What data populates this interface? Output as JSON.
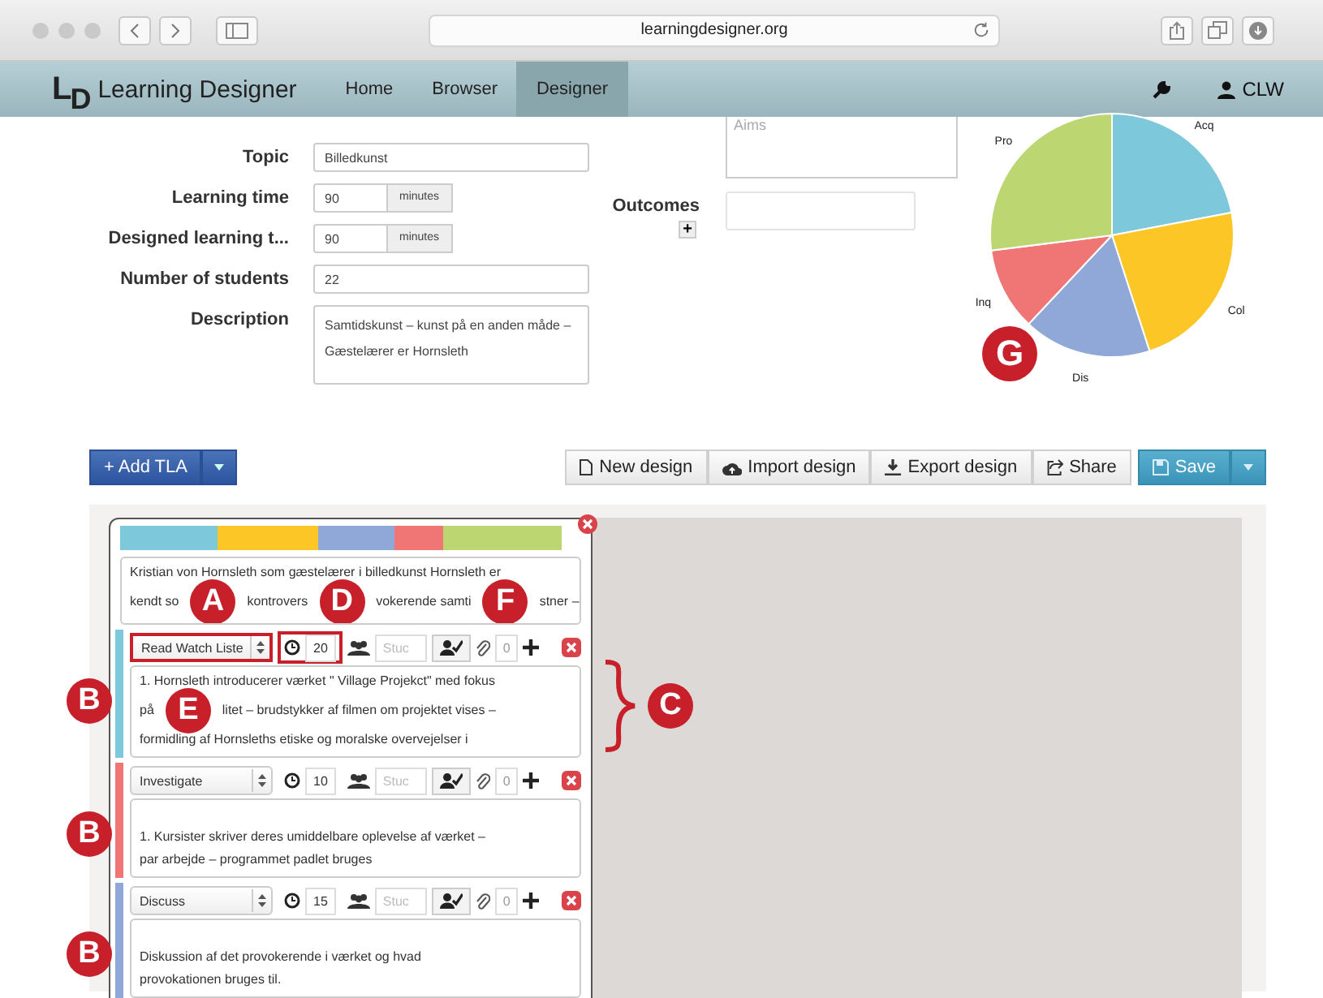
{
  "browser": {
    "address": "learningdesigner.org"
  },
  "nav": {
    "logo_l": "L",
    "logo_d": "D",
    "brand": "Learning Designer",
    "items": [
      {
        "label": "Home",
        "selected": false
      },
      {
        "label": "Browser",
        "selected": false
      },
      {
        "label": "Designer",
        "selected": true
      }
    ],
    "user": "CLW"
  },
  "form": [
    {
      "kind": "text",
      "label": "Topic",
      "value": "Billedkunst"
    },
    {
      "kind": "unit",
      "label": "Learning time",
      "value": "90",
      "unit": "minutes"
    },
    {
      "kind": "unit",
      "label": "Designed learning t...",
      "value": "90",
      "unit": "minutes"
    },
    {
      "kind": "text",
      "label": "Number of students",
      "value": "22"
    },
    {
      "kind": "area",
      "label": "Description",
      "value": "Samtidskunst – kunst på en anden måde – Gæstelærer er Hornsleth"
    }
  ],
  "aims": {
    "placeholder": "Aims"
  },
  "outcomes": {
    "label": "Outcomes",
    "add": "+"
  },
  "learning_types": [
    {
      "label": "Acq",
      "color": "#7ec8dc"
    },
    {
      "label": "Col",
      "color": "#fcc726"
    },
    {
      "label": "Dis",
      "color": "#8fa8d8"
    },
    {
      "label": "Inq",
      "color": "#f07575"
    },
    {
      "label": "Pro",
      "color": "#bcd672"
    }
  ],
  "pie_marker": "G",
  "toolbar": {
    "add": "+ Add TLA",
    "buttons": [
      {
        "kind": "new",
        "label": "New design"
      },
      {
        "kind": "import",
        "label": "Import design"
      },
      {
        "kind": "export",
        "label": "Export design"
      },
      {
        "kind": "share",
        "label": "Share"
      }
    ],
    "save": "Save"
  },
  "tla": {
    "description": [
      [
        {
          "kind": "text",
          "text": "Kristian von Hornsleth som gæstelærer i billedkunst Hornsleth er"
        }
      ],
      [
        {
          "kind": "text",
          "text": "kendt so"
        },
        {
          "kind": "marker",
          "letter": "A"
        },
        {
          "kind": "text",
          "text": "kontrovers"
        },
        {
          "kind": "marker",
          "letter": "D"
        },
        {
          "kind": "text",
          "text": "vokerende samti"
        },
        {
          "kind": "marker",
          "letter": "F"
        },
        {
          "kind": "text",
          "text": "stner –"
        }
      ]
    ],
    "activities": [
      {
        "type": "Read Watch Liste",
        "color": "#7ec8dc",
        "time": "20",
        "students": "Stuc",
        "count": "0",
        "highlighted": true,
        "marker": "B",
        "brace": "C",
        "lines": [
          [
            {
              "kind": "text",
              "text": "1. Hornsleth introducerer værket \" Village Projekct\" med fokus"
            }
          ],
          [
            {
              "kind": "text",
              "text": "på"
            },
            {
              "kind": "marker",
              "letter": "E"
            },
            {
              "kind": "text",
              "text": "litet – brudstykker af filmen om projektet vises –"
            }
          ],
          [
            {
              "kind": "text",
              "text": "formidling af Hornsleths etiske og moralske overvejelser i"
            }
          ]
        ]
      },
      {
        "type": "Investigate",
        "color": "#f07575",
        "time": "10",
        "students": "Stuc",
        "count": "0",
        "highlighted": false,
        "marker": "B",
        "lines": [
          [
            {
              "kind": "text",
              "text": "1. Kursister skriver deres umiddelbare oplevelse af værket  –"
            }
          ],
          [
            {
              "kind": "text",
              "text": "par arbejde – programmet padlet bruges"
            }
          ]
        ]
      },
      {
        "type": "Discuss",
        "color": "#8fa8d8",
        "time": "15",
        "students": "Stuc",
        "count": "0",
        "highlighted": false,
        "marker": "B",
        "lines": [
          [
            {
              "kind": "text",
              "text": "Diskussion af det provokerende i værket og hvad"
            }
          ],
          [
            {
              "kind": "text",
              "text": "provokationen bruges til."
            }
          ]
        ]
      }
    ]
  }
}
